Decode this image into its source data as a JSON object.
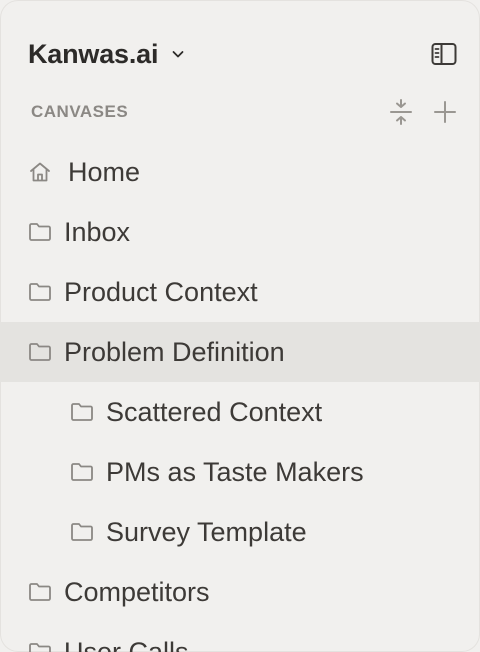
{
  "workspace": {
    "name": "Kanwas.ai",
    "chevron_icon": "chevron-down-icon",
    "toggle_icon": "sidebar-toggle-icon"
  },
  "section": {
    "title": "CANVASES",
    "actions": [
      "collapse-expand-icon",
      "plus-icon"
    ]
  },
  "canvases": [
    {
      "label": "Home",
      "icon": "home-icon",
      "level": 0,
      "selected": false
    },
    {
      "label": "Inbox",
      "icon": "folder-icon",
      "level": 0,
      "selected": false
    },
    {
      "label": "Product Context",
      "icon": "folder-icon",
      "level": 0,
      "selected": false
    },
    {
      "label": "Problem Definition",
      "icon": "folder-icon",
      "level": 0,
      "selected": true
    },
    {
      "label": "Scattered Context",
      "icon": "folder-icon",
      "level": 1,
      "selected": false
    },
    {
      "label": "PMs as Taste Makers",
      "icon": "folder-icon",
      "level": 1,
      "selected": false
    },
    {
      "label": "Survey Template",
      "icon": "folder-icon",
      "level": 1,
      "selected": false
    },
    {
      "label": "Competitors",
      "icon": "folder-icon",
      "level": 0,
      "selected": false
    },
    {
      "label": "User Calls",
      "icon": "folder-icon",
      "level": 0,
      "selected": false
    }
  ],
  "colors": {
    "background": "#f1f0ee",
    "selected_row": "#e4e3e0",
    "text": "#3d3a37",
    "muted": "#8b8884"
  }
}
